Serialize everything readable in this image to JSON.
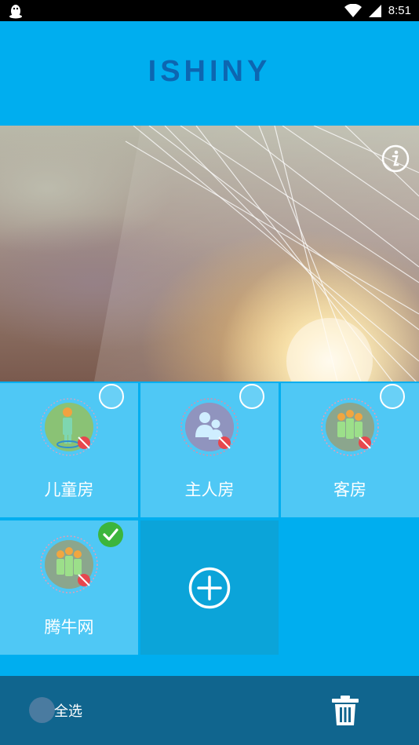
{
  "status_bar": {
    "time": "8:51",
    "left_icon": "penguin-icon",
    "wifi_icon": "wifi-icon",
    "signal_icon": "signal-icon"
  },
  "header": {
    "title": "ISHINY"
  },
  "banner": {
    "info_icon": "info-icon"
  },
  "rooms": [
    {
      "name": "儿童房",
      "icon": "child-room-icon",
      "selected": false
    },
    {
      "name": "主人房",
      "icon": "master-room-icon",
      "selected": false
    },
    {
      "name": "客房",
      "icon": "guest-room-icon",
      "selected": false
    },
    {
      "name": "腾牛网",
      "icon": "group-room-icon",
      "selected": true
    }
  ],
  "add_button": {
    "icon": "plus-circle-icon"
  },
  "bottom_bar": {
    "select_all_label": "全选",
    "delete_icon": "trash-icon"
  },
  "colors": {
    "primary": "#00aeef",
    "tile": "#4fc8f5",
    "add_tile": "#0ba4d9",
    "bottom_bar": "#10658e",
    "title": "#0d66b1",
    "check": "#3cb53c"
  }
}
